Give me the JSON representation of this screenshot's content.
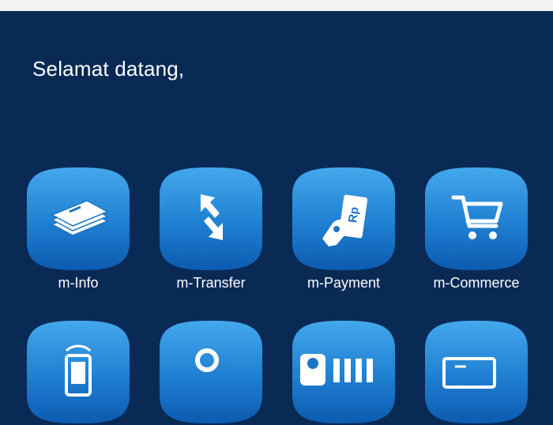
{
  "header": {
    "greeting": "Selamat datang,"
  },
  "menu": {
    "row1": [
      {
        "label": "m-Info",
        "icon": "documents-icon"
      },
      {
        "label": "m-Transfer",
        "icon": "transfer-arrows-icon"
      },
      {
        "label": "m-Payment",
        "icon": "payment-rupiah-icon"
      },
      {
        "label": "m-Commerce",
        "icon": "shopping-cart-icon"
      }
    ],
    "row2": [
      {
        "icon": "mobile-phone-icon"
      },
      {
        "icon": "location-icon"
      },
      {
        "icon": "user-card-icon"
      },
      {
        "icon": "card-icon"
      }
    ]
  },
  "colors": {
    "background": "#0a2a56",
    "tile_top": "#3ea2e8",
    "tile_bottom": "#0e5fb4",
    "text": "#ffffff"
  }
}
